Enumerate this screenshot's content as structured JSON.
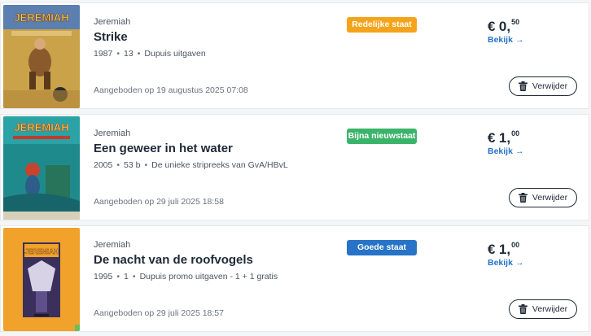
{
  "items": [
    {
      "series": "Jeremiah",
      "title": "Strike",
      "year": "1987",
      "number": "13",
      "publisher": "Dupuis uitgaven",
      "offered": "Aangeboden op 19 augustus 2025 07:08",
      "condition": "Redelijke staat",
      "condition_color": "#f5a31a",
      "price_currency": "€",
      "price_whole": "0,",
      "price_cents": "50",
      "view_label": "Bekijk",
      "remove_label": "Verwijder",
      "cover_text": "JEREMIAH"
    },
    {
      "series": "Jeremiah",
      "title": "Een geweer in het water",
      "year": "2005",
      "number": "53 b",
      "publisher": "De unieke stripreeks van GvA/HBvL",
      "offered": "Aangeboden op 29 juli 2025 18:58",
      "condition": "Bijna nieuwstaat",
      "condition_color": "#3bb46a",
      "price_currency": "€",
      "price_whole": "1,",
      "price_cents": "00",
      "view_label": "Bekijk",
      "remove_label": "Verwijder",
      "cover_text": "JEREMIAH"
    },
    {
      "series": "Jeremiah",
      "title": "De nacht van de roofvogels",
      "year": "1995",
      "number": "1",
      "publisher": "Dupuis promo uitgaven - 1 + 1 gratis",
      "offered": "Aangeboden op 29 juli 2025 18:57",
      "condition": "Goede staat",
      "condition_color": "#2673c7",
      "price_currency": "€",
      "price_whole": "1,",
      "price_cents": "00",
      "view_label": "Bekijk",
      "remove_label": "Verwijder",
      "cover_text": "JEREMIAH"
    }
  ],
  "icons": {
    "arrow": "→",
    "separator": "•",
    "trash": "trash-icon"
  }
}
